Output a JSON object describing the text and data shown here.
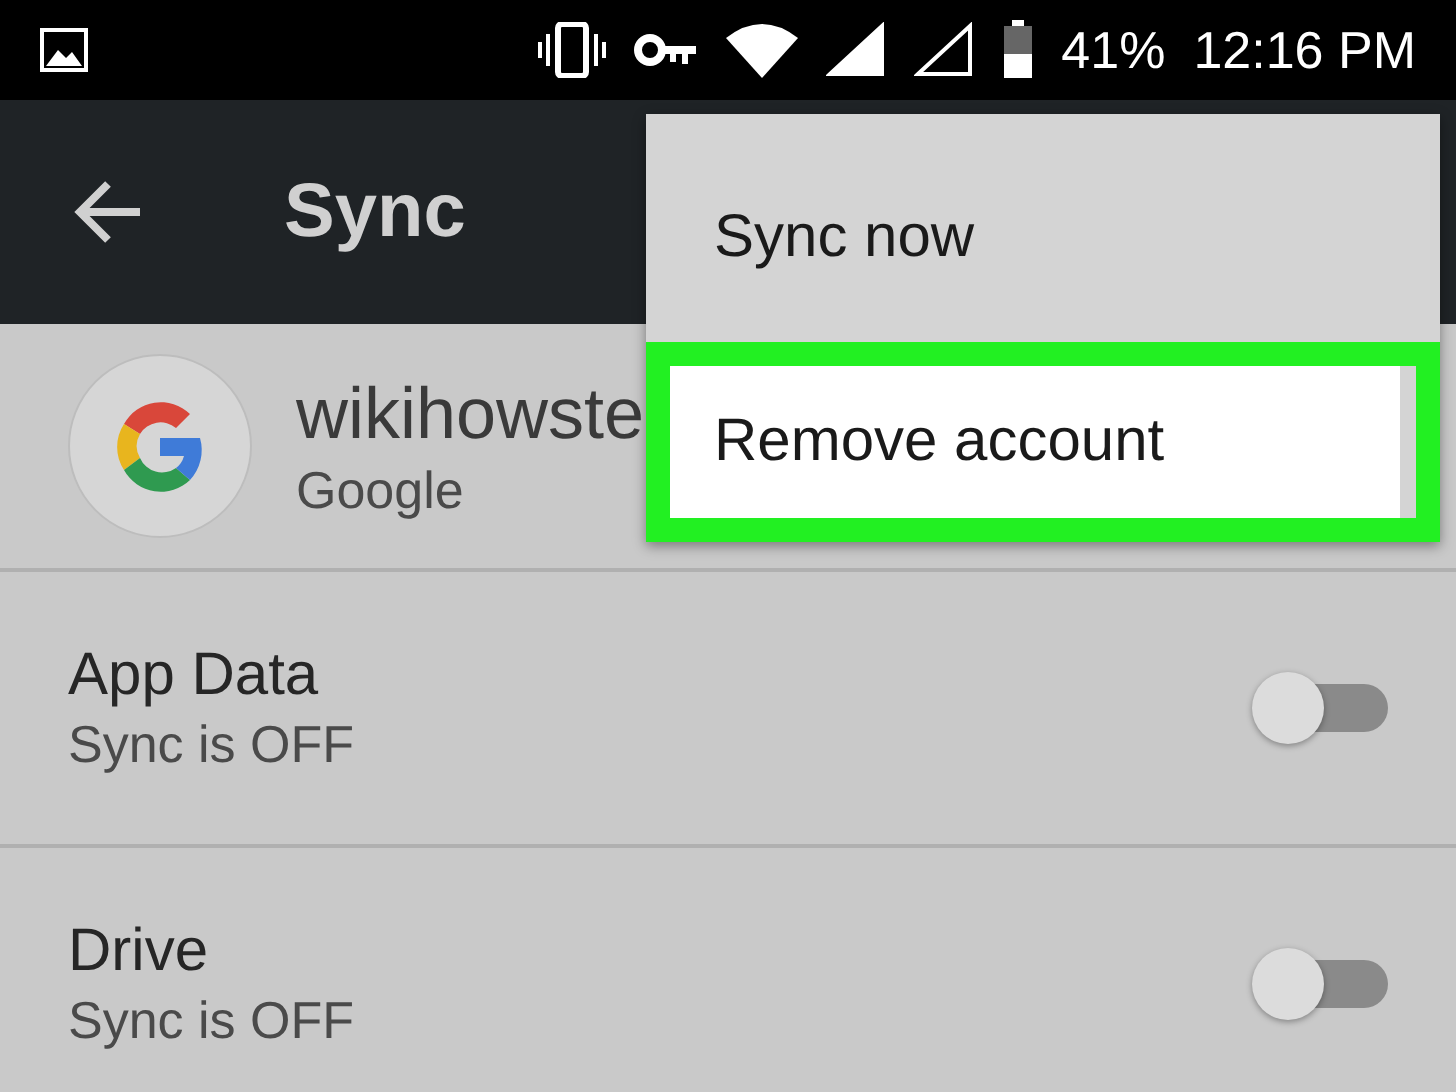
{
  "status_bar": {
    "battery": "41%",
    "time": "12:16 PM"
  },
  "toolbar": {
    "title": "Sync"
  },
  "account": {
    "name": "wikihowste",
    "provider": "Google"
  },
  "sync_items": [
    {
      "title": "App Data",
      "status": "Sync is OFF",
      "on": false
    },
    {
      "title": "Drive",
      "status": "Sync is OFF",
      "on": false
    }
  ],
  "menu": {
    "items": [
      {
        "label": "Sync now",
        "highlighted": false
      },
      {
        "label": "Remove account",
        "highlighted": true
      }
    ]
  }
}
